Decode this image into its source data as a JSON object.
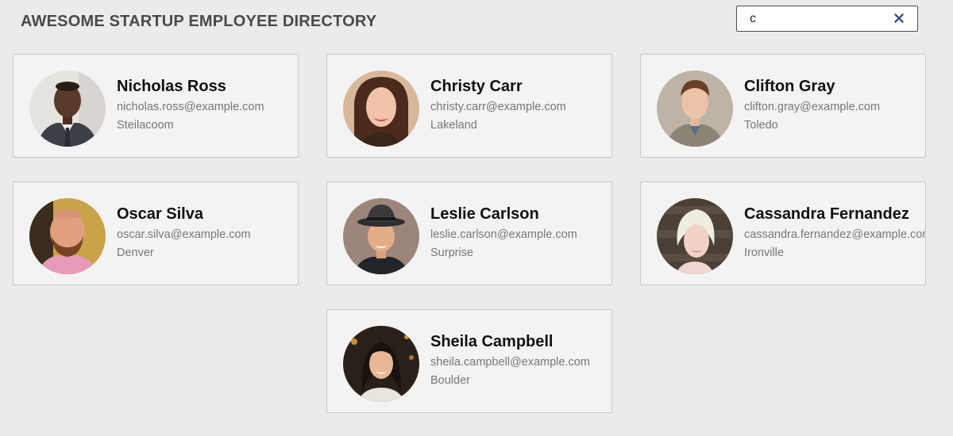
{
  "header": {
    "title": "AWESOME STARTUP EMPLOYEE DIRECTORY"
  },
  "search": {
    "value": "c",
    "clear_icon": "close-icon"
  },
  "colors": {
    "background": "#ebebeb",
    "card_background": "#f3f3f3",
    "card_border": "#c8c8c8",
    "clear_icon": "#3b5a8a"
  },
  "employees": [
    {
      "name": "Nicholas Ross",
      "email": "nicholas.ross@example.com",
      "city": "Steilacoom"
    },
    {
      "name": "Christy Carr",
      "email": "christy.carr@example.com",
      "city": "Lakeland"
    },
    {
      "name": "Clifton Gray",
      "email": "clifton.gray@example.com",
      "city": "Toledo"
    },
    {
      "name": "Oscar Silva",
      "email": "oscar.silva@example.com",
      "city": "Denver"
    },
    {
      "name": "Leslie Carlson",
      "email": "leslie.carlson@example.com",
      "city": "Surprise"
    },
    {
      "name": "Cassandra Fernandez",
      "email": "cassandra.fernandez@example.com",
      "city": "Ironville"
    },
    {
      "name": "Sheila Campbell",
      "email": "sheila.campbell@example.com",
      "city": "Boulder"
    }
  ]
}
